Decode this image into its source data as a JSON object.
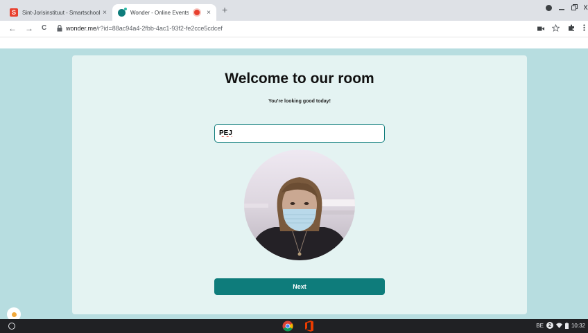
{
  "browser": {
    "tabs": [
      {
        "title": "Sint-Jorisinstituut - Smartschool",
        "favicon_letter": "S",
        "close": "×"
      },
      {
        "title": "Wonder - Online Events",
        "close": "×"
      }
    ],
    "new_tab": "+",
    "url_domain": "wonder.me",
    "url_path": "/r?id=88ac94a4-2fbb-4ac1-93f2-fe2cce5cdcef",
    "nav": {
      "back": "←",
      "forward": "→",
      "reload": "C"
    }
  },
  "page": {
    "title": "Welcome to our room",
    "subtitle": "You're looking good today!",
    "name_value": "PEJ",
    "next_label": "Next"
  },
  "taskbar": {
    "keyboard_layout": "BE",
    "notification_count": "2",
    "time": "10:32"
  },
  "colors": {
    "accent": "#0e7c7b",
    "page_bg": "#b7dde0",
    "card_bg": "#e4f3f2"
  }
}
